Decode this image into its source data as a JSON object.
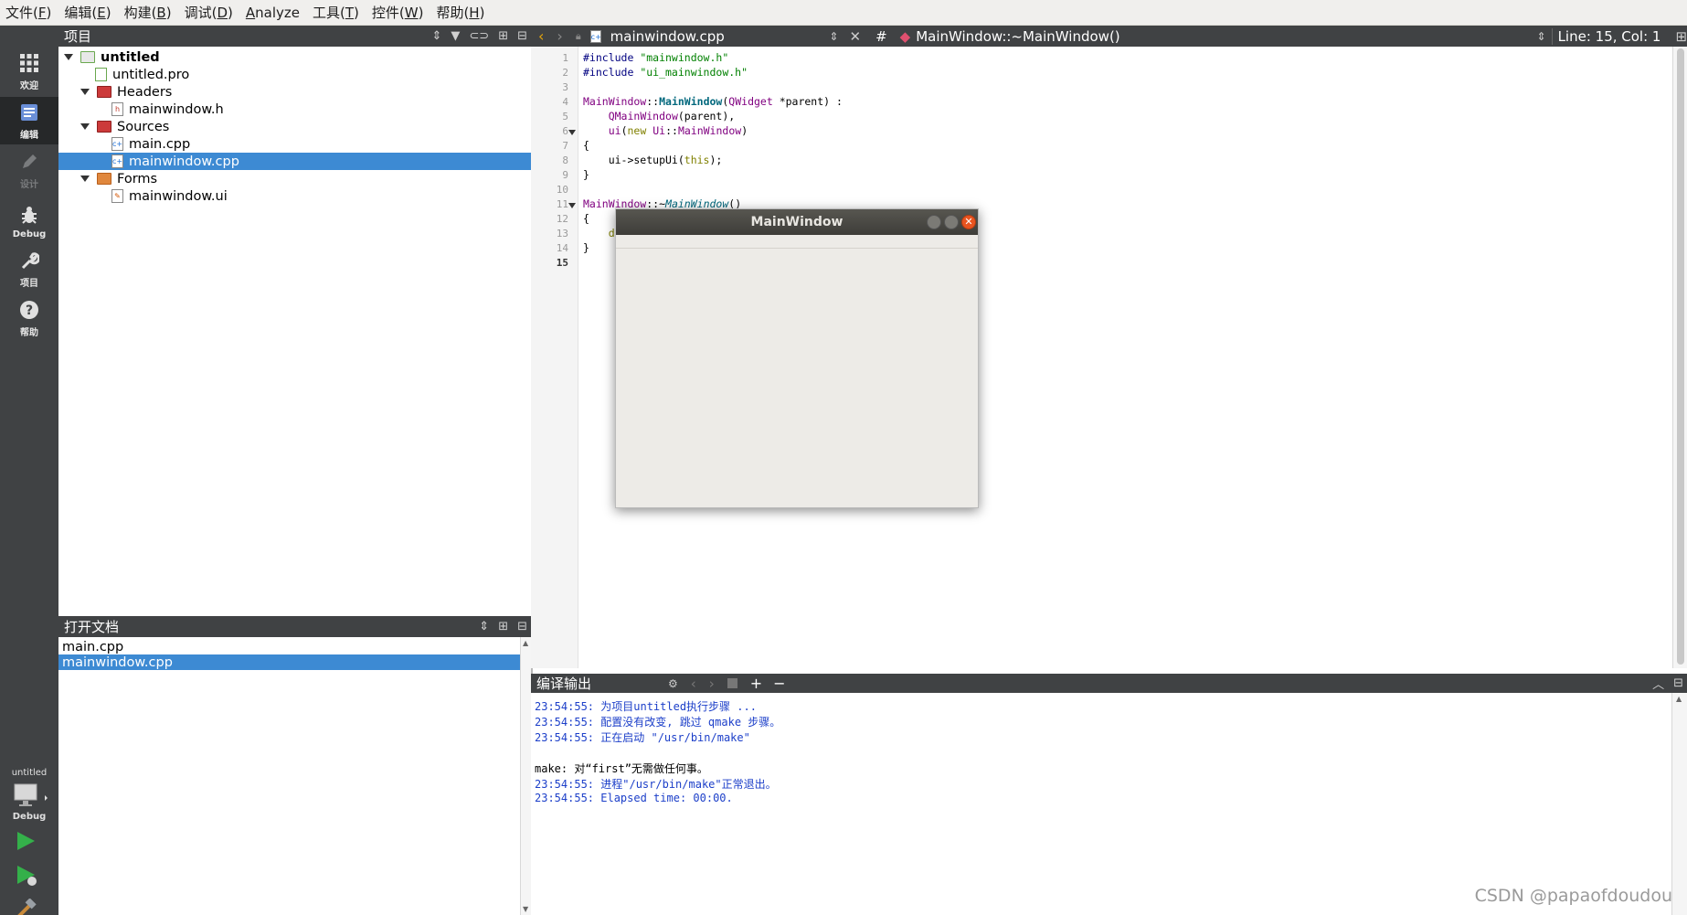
{
  "menubar": {
    "items": [
      {
        "label": "文件(",
        "key": "F",
        "tail": ")"
      },
      {
        "label": "编辑(",
        "key": "E",
        "tail": ")"
      },
      {
        "label": "构建(",
        "key": "B",
        "tail": ")"
      },
      {
        "label": "调试(",
        "key": "D",
        "tail": ")"
      },
      {
        "label": "",
        "key": "A",
        "tail": "nalyze"
      },
      {
        "label": "工具(",
        "key": "T",
        "tail": ")"
      },
      {
        "label": "控件(",
        "key": "W",
        "tail": ")"
      },
      {
        "label": "帮助(",
        "key": "H",
        "tail": ")"
      }
    ]
  },
  "modes": {
    "welcome": "欢迎",
    "edit": "编辑",
    "design": "设计",
    "debug": "Debug",
    "projects": "项目",
    "help": "帮助",
    "target_project": "untitled",
    "target_config": "Debug"
  },
  "projects_panel": {
    "title": "项目",
    "tree": {
      "root": "untitled",
      "pro_file": "untitled.pro",
      "headers_label": "Headers",
      "header_file": "mainwindow.h",
      "sources_label": "Sources",
      "source_main": "main.cpp",
      "source_mainwindow": "mainwindow.cpp",
      "forms_label": "Forms",
      "form_file": "mainwindow.ui"
    }
  },
  "open_docs": {
    "title": "打开文档",
    "items": [
      "main.cpp",
      "mainwindow.cpp"
    ],
    "selected_index": 1
  },
  "editor": {
    "file_name": "mainwindow.cpp",
    "hash": "#",
    "symbol": "MainWindow::~MainWindow()",
    "position": "Line: 15, Col: 1",
    "line_numbers": [
      "1",
      "2",
      "3",
      "4",
      "5",
      "6",
      "7",
      "8",
      "9",
      "10",
      "11",
      "12",
      "13",
      "14",
      "15"
    ],
    "current_line": 15
  },
  "popup": {
    "title": "MainWindow"
  },
  "output": {
    "title": "编译输出",
    "lines": [
      "23:54:55: 为项目untitled执行步骤 ...",
      "23:54:55: 配置没有改变, 跳过 qmake 步骤。",
      "23:54:55: 正在启动 \"/usr/bin/make\"",
      "",
      "make: 对“first”无需做任何事。",
      "23:54:55: 进程\"/usr/bin/make\"正常退出。",
      "23:54:55: Elapsed time: 00:00."
    ]
  },
  "watermark": "CSDN @papaofdoudou",
  "colors": {
    "selection": "#3d8ad3",
    "panel_header": "#404244",
    "output_text": "#1c3fc9",
    "popup_close": "#e95420"
  }
}
